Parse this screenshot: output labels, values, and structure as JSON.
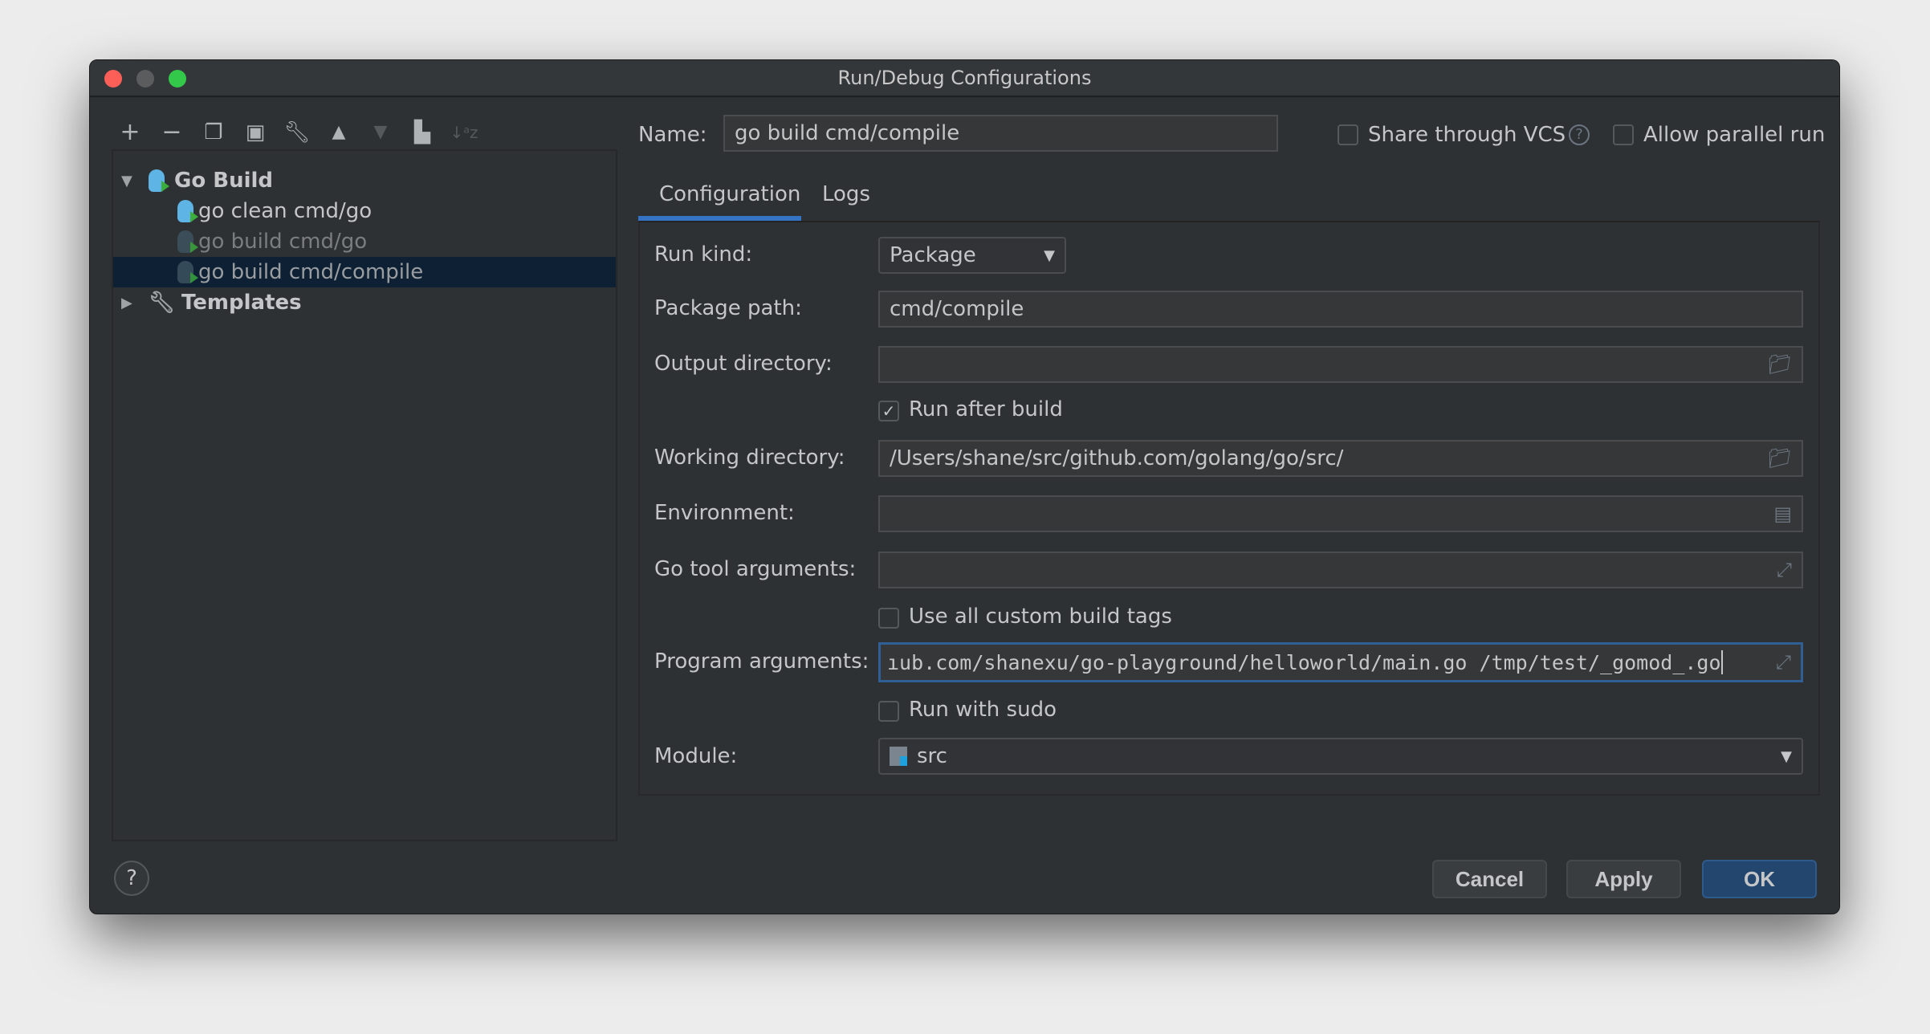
{
  "window": {
    "title": "Run/Debug Configurations"
  },
  "toolbar": {
    "icons": [
      "add-icon",
      "remove-icon",
      "copy-icon",
      "save-icon",
      "wrench-icon",
      "move-up-icon",
      "move-down-icon",
      "new-folder-icon",
      "sort-icon"
    ]
  },
  "tree": {
    "group": "Go Build",
    "items": [
      "go clean cmd/go",
      "go build cmd/go",
      "go build cmd/compile"
    ],
    "templates": "Templates"
  },
  "header": {
    "name_label": "Name:",
    "name_value": "go build cmd/compile",
    "share_label": "Share through VCS",
    "parallel_label": "Allow parallel run"
  },
  "tabs": [
    "Configuration",
    "Logs"
  ],
  "form": {
    "run_kind_label": "Run kind:",
    "run_kind_value": "Package",
    "package_path_label": "Package path:",
    "package_path_value": "cmd/compile",
    "output_dir_label": "Output directory:",
    "output_dir_value": "",
    "run_after_build_label": "Run after build",
    "working_dir_label": "Working directory:",
    "working_dir_value": "/Users/shane/src/github.com/golang/go/src/",
    "environment_label": "Environment:",
    "environment_value": "",
    "go_tool_args_label": "Go tool arguments:",
    "go_tool_args_value": "",
    "custom_tags_label": "Use all custom build tags",
    "program_args_label": "Program arguments:",
    "program_args_value": "ıub.com/shanexu/go-playground/helloworld/main.go /tmp/test/_gomod_.go",
    "sudo_label": "Run with sudo",
    "module_label": "Module:",
    "module_value": "src"
  },
  "footer": {
    "help": "?",
    "cancel": "Cancel",
    "apply": "Apply",
    "ok": "OK"
  }
}
